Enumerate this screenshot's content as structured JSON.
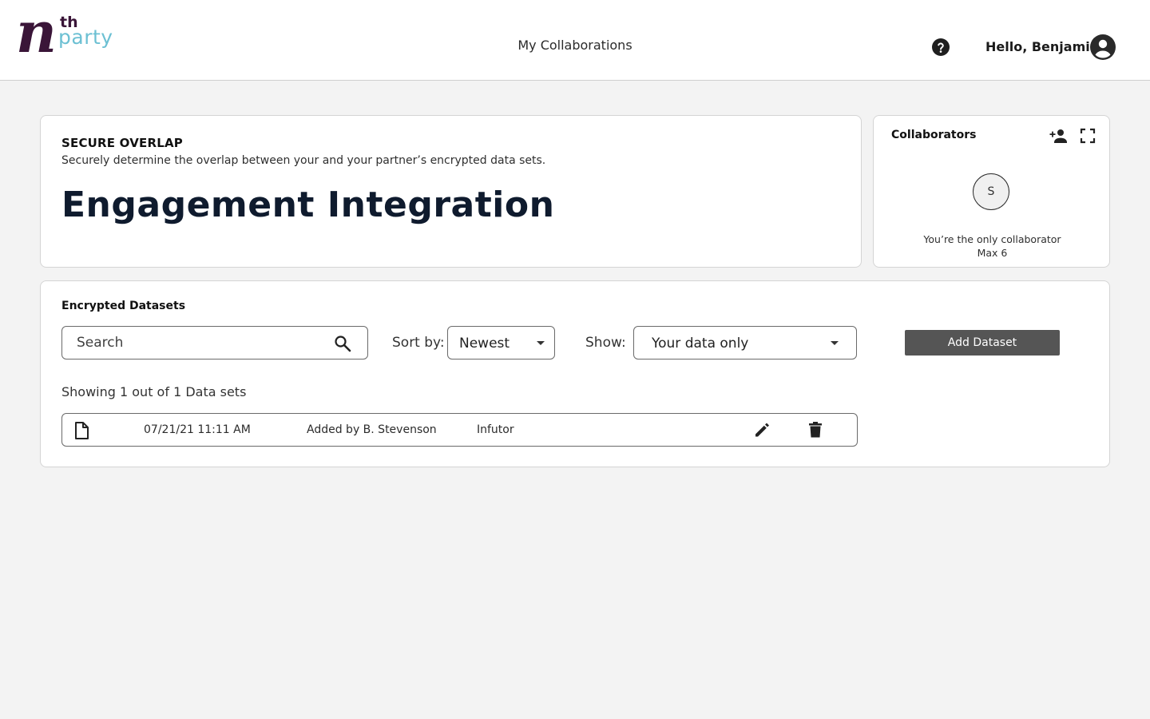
{
  "header": {
    "logo": {
      "n": "n",
      "th": "th",
      "party": "party"
    },
    "nav_label": "My Collaborations",
    "greeting": "Hello, Benjamin",
    "icons": {
      "help": "help-circle-icon",
      "account": "account-circle-icon"
    }
  },
  "overview": {
    "type_label": "SECURE OVERLAP",
    "description": "Securely determine the overlap between your and your partner’s encrypted data sets.",
    "title": "Engagement Integration"
  },
  "collaborators": {
    "title": "Collaborators",
    "avatar_initial": "S",
    "note_line1": "You’re the only collaborator",
    "note_line2": "Max 6",
    "icons": {
      "add": "add-person-icon",
      "expand": "fullscreen-icon"
    }
  },
  "datasets": {
    "title": "Encrypted Datasets",
    "search_placeholder": "Search",
    "sort_label": "Sort by:",
    "sort_value": "Newest",
    "show_label": "Show:",
    "show_value": "Your data only",
    "add_button": "Add Dataset",
    "showing": "Showing 1 out of 1 Data sets",
    "rows": [
      {
        "date": "07/21/21 11:11 AM",
        "added_by": "Added by B. Stevenson",
        "source": "Infutor"
      }
    ]
  },
  "colors": {
    "brand_dark": "#3a1538",
    "brand_light": "#6cc0d3",
    "button_bg": "#555555",
    "page_bg": "#f3f3f3"
  }
}
